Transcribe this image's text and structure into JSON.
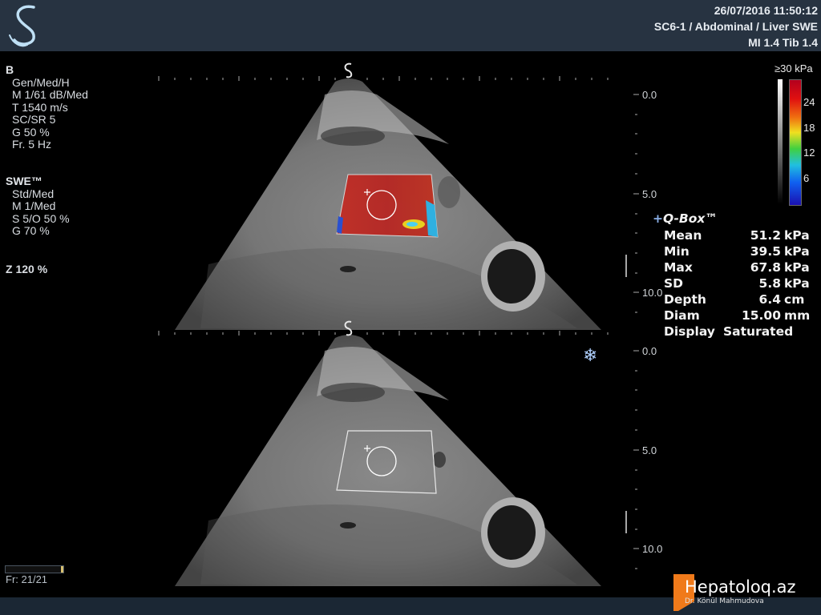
{
  "header": {
    "datetime": "26/07/2016 11:50:12",
    "probe_preset": "SC6-1 / Abdominal / Liver SWE",
    "mi_tib": "MI 1.4  Tib  1.4"
  },
  "b_mode": {
    "title": "B",
    "params": [
      "Gen/Med/H",
      "M 1/61 dB/Med",
      "T 1540 m/s",
      "SC/SR 5",
      "G 50 %",
      "Fr. 5 Hz"
    ]
  },
  "swe": {
    "title": "SWE™",
    "params": [
      "Std/Med",
      "M 1/Med",
      "S 5/O 50 %",
      "G 70 %"
    ]
  },
  "zoom": "Z  120  %",
  "frame_counter": "Fr: 21/21",
  "cine_progress": 1.0,
  "colorbar": {
    "unit": "≥30 kPa",
    "ticks": [
      "24",
      "18",
      "12",
      "6"
    ]
  },
  "depth_scale": {
    "top_image": [
      "0.0",
      "5.0",
      "10.0"
    ],
    "bottom_image": [
      "0.0",
      "5.0",
      "10.0"
    ]
  },
  "qbox": {
    "title": "Q-Box™",
    "rows": [
      {
        "label": "Mean",
        "value": "51.2",
        "unit": "kPa"
      },
      {
        "label": "Min",
        "value": "39.5",
        "unit": "kPa"
      },
      {
        "label": "Max",
        "value": "67.8",
        "unit": "kPa"
      },
      {
        "label": "SD",
        "value": "5.8",
        "unit": "kPa"
      },
      {
        "label": "Depth",
        "value": "6.4",
        "unit": "cm"
      },
      {
        "label": "Diam",
        "value": "15.00",
        "unit": "mm"
      },
      {
        "label": "Display",
        "value": "Saturated",
        "unit": ""
      }
    ]
  },
  "icons": {
    "logo": "supersonic-s-logo",
    "orientation": "orientation-s-marker",
    "freeze": "snowflake-icon"
  },
  "watermark": {
    "brand": "Hepatoloq.az",
    "author": "Dr. Könül Mahmudova"
  },
  "colors": {
    "header_bg": "#273341",
    "accent_blue": "#8ab0e8",
    "swe_red": "#c0201c",
    "watermark_orange": "#f07a1a"
  }
}
